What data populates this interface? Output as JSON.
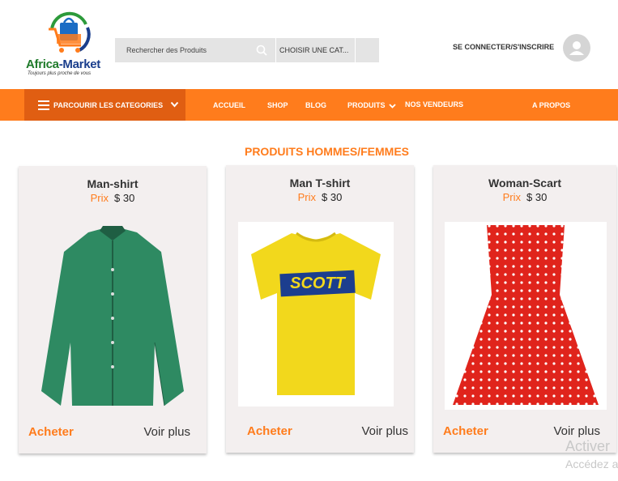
{
  "header": {
    "logo": {
      "brand_part1": "Africa",
      "brand_part2": "-Market",
      "tagline": "Toujours plus proche de vous"
    },
    "search": {
      "placeholder": "Rechercher des Produits",
      "category_label": "CHOISIR UNE CAT..."
    },
    "login_label": "SE CONNECTER/S'INSCRIRE"
  },
  "nav": {
    "categories_label": "PARCOURIR LES CATEGORIES",
    "links": [
      "ACCUEIL",
      "SHOP",
      "BLOG",
      "PRODUITS",
      "NOS VENDEURS",
      "A PROPOS"
    ]
  },
  "section": {
    "title": "PRODUITS HOMMES/FEMMES"
  },
  "products": [
    {
      "name": "Man-shirt",
      "price_label": "Prix",
      "price": "$ 30",
      "buy_label": "Acheter",
      "more_label": "Voir plus",
      "color": "#2e8a62"
    },
    {
      "name": "Man T-shirt",
      "price_label": "Prix",
      "price": "$ 30",
      "buy_label": "Acheter",
      "more_label": "Voir plus",
      "color": "#f2d81c"
    },
    {
      "name": "Woman-Scart",
      "price_label": "Prix",
      "price": "$ 30",
      "buy_label": "Acheter",
      "more_label": "Voir plus",
      "color": "#e0241c"
    }
  ],
  "tshirt_print": "SCOTT",
  "watermark": {
    "line1": "Activer",
    "line2": "Accédez a"
  },
  "colors": {
    "accent": "#ff7c1c",
    "accent_dark": "#e05e12"
  }
}
